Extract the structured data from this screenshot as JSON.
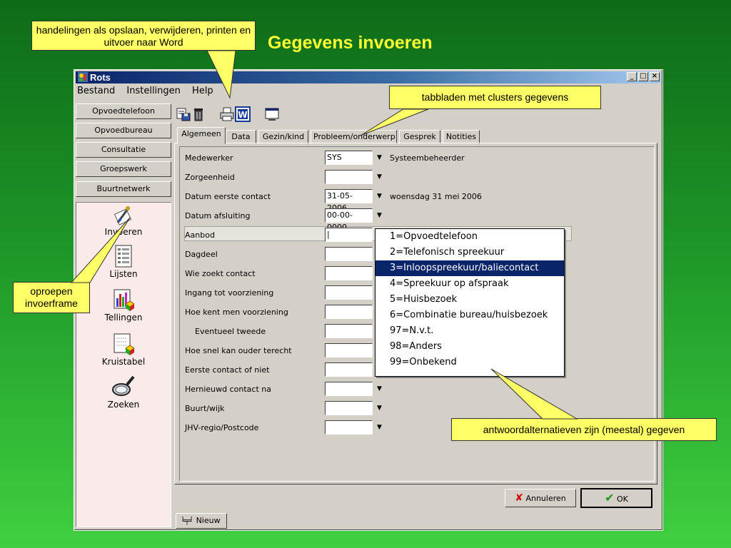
{
  "slide": {
    "title": "Gegevens invoeren",
    "callouts": {
      "top_left": "handelingen als opslaan, verwijderen, printen en uitvoer naar Word",
      "tabs": "tabbladen met clusters gegevens",
      "left": "oproepen invoerframe",
      "bottom": "antwoordalternatieven zijn (meestal) gegeven"
    },
    "callout_color": "#ffff66",
    "title_color": "#ffff33"
  },
  "window": {
    "title": "Rots",
    "controls": {
      "minimize": "_",
      "maximize": "□",
      "close": "×"
    },
    "menu": [
      "Bestand",
      "Instellingen",
      "Help"
    ]
  },
  "sidebar": {
    "buttons": [
      "Opvoedtelefoon",
      "Opvoedbureau",
      "Consultatie",
      "Groepswerk",
      "Buurtnetwerk"
    ],
    "tools": [
      {
        "label": "Invoeren",
        "icon": "pen-writing-icon"
      },
      {
        "label": "Lijsten",
        "icon": "list-document-icon"
      },
      {
        "label": "Tellingen",
        "icon": "bar-chart-icon"
      },
      {
        "label": "Kruistabel",
        "icon": "crosstab-icon"
      },
      {
        "label": "Zoeken",
        "icon": "magnifier-icon"
      }
    ]
  },
  "toolbar": {
    "icons": [
      "save-icon",
      "delete-icon",
      "print-icon",
      "word-icon",
      "screen-icon"
    ]
  },
  "tabs": [
    "Algemeen",
    "Data",
    "Gezin/kind",
    "Probleem/onderwerp",
    "Gesprek",
    "Notities"
  ],
  "form": {
    "fields": [
      {
        "label": "Medewerker",
        "value": "SYS",
        "dropdown": true,
        "extra": "Systeembeheerder"
      },
      {
        "label": "Zorgeenheid",
        "value": "",
        "dropdown": true,
        "extra": ""
      },
      {
        "label": "Datum eerste contact",
        "value": "31-05-2006",
        "dropdown": true,
        "extra": "woensdag 31 mei 2006"
      },
      {
        "label": "Datum afsluiting",
        "value": "00-00-0000",
        "dropdown": true,
        "extra": ""
      },
      {
        "label": "Aanbod",
        "value": "|",
        "dropdown": false,
        "extra": ""
      },
      {
        "label": "Dagdeel",
        "value": "",
        "dropdown": false,
        "extra": ""
      },
      {
        "label": "Wie zoekt contact",
        "value": "",
        "dropdown": false,
        "extra": ""
      },
      {
        "label": "Ingang tot voorziening",
        "value": "",
        "dropdown": false,
        "extra": ""
      },
      {
        "label": "Hoe kent men voorziening",
        "value": "",
        "dropdown": false,
        "extra": ""
      },
      {
        "label": "Eventueel tweede",
        "value": "",
        "dropdown": false,
        "extra": ""
      },
      {
        "label": "Hoe snel kan ouder terecht",
        "value": "",
        "dropdown": false,
        "extra": ""
      },
      {
        "label": "Eerste contact of niet",
        "value": "",
        "dropdown": false,
        "extra": ""
      },
      {
        "label": "Hernieuwd contact na",
        "value": "",
        "dropdown": true,
        "extra": ""
      },
      {
        "label": "Buurt/wijk",
        "value": "",
        "dropdown": true,
        "extra": ""
      },
      {
        "label": "JHV-regio/Postcode",
        "value": "",
        "dropdown": true,
        "extra": ""
      }
    ],
    "dropdown_options": [
      "1=Opvoedtelefoon",
      "2=Telefonisch spreekuur",
      "3=Inloopspreekuur/baliecontact",
      "4=Spreekuur op afspraak",
      "5=Huisbezoek",
      "6=Combinatie bureau/huisbezoek",
      "97=N.v.t.",
      "98=Anders",
      "99=Onbekend"
    ],
    "selected_option": 2
  },
  "buttons": {
    "cancel": "Annuleren",
    "ok": "OK"
  },
  "bottom_tab": "Nieuw"
}
